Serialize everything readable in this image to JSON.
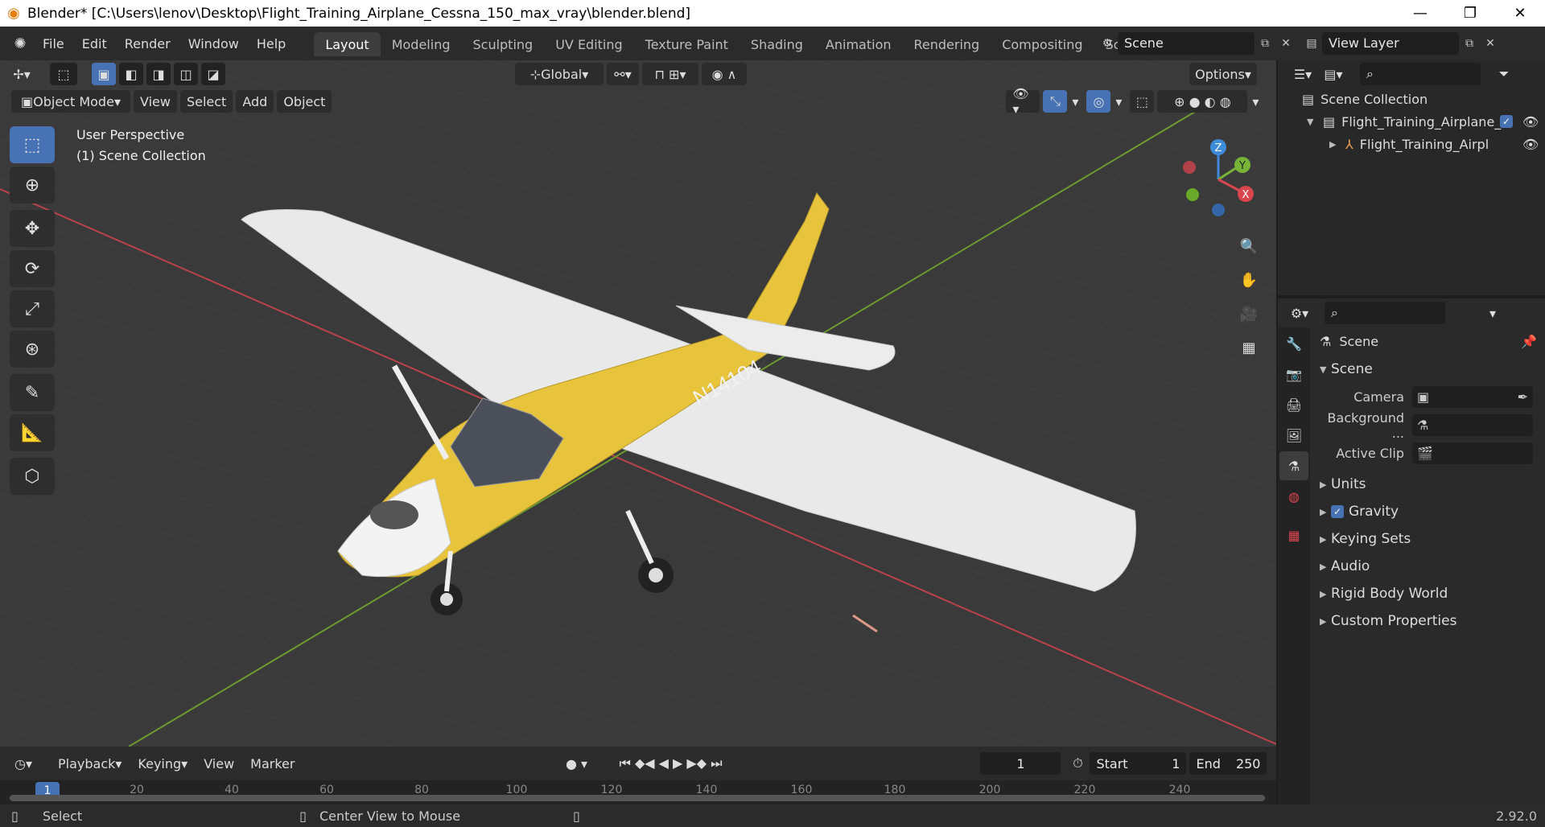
{
  "window": {
    "title": "Blender* [C:\\Users\\lenov\\Desktop\\Flight_Training_Airplane_Cessna_150_max_vray\\blender.blend]",
    "minimize": "—",
    "restore": "❐",
    "close": "✕"
  },
  "menu": [
    "File",
    "Edit",
    "Render",
    "Window",
    "Help"
  ],
  "workspaces": [
    "Layout",
    "Modeling",
    "Sculpting",
    "UV Editing",
    "Texture Paint",
    "Shading",
    "Animation",
    "Rendering",
    "Compositing",
    "Scripting"
  ],
  "active_workspace": "Layout",
  "scene": {
    "name": "Scene",
    "view_layer": "View Layer"
  },
  "viewport": {
    "transform_orientation": "Global",
    "options_label": "Options",
    "mode": "Object Mode",
    "menus": [
      "View",
      "Select",
      "Add",
      "Object"
    ],
    "perspective": "User Perspective",
    "collection": "(1) Scene Collection",
    "axis_x": "X",
    "axis_y": "Y",
    "axis_z": "Z",
    "tail_text": "N14104"
  },
  "outliner": {
    "root": "Scene Collection",
    "collection": "Flight_Training_Airplane_",
    "object": "Flight_Training_Airpl"
  },
  "properties": {
    "context": "Scene",
    "section_title": "Scene",
    "camera_label": "Camera",
    "background_label": "Background ...",
    "active_clip_label": "Active Clip",
    "subpanels": [
      "Units",
      "Gravity",
      "Keying Sets",
      "Audio",
      "Rigid Body World",
      "Custom Properties"
    ]
  },
  "timeline": {
    "menus": [
      "Playback",
      "Keying",
      "View",
      "Marker"
    ],
    "current_frame": "1",
    "start_label": "Start",
    "start": "1",
    "end_label": "End",
    "end": "250",
    "ticks": [
      "1",
      "20",
      "40",
      "60",
      "80",
      "100",
      "120",
      "140",
      "160",
      "180",
      "200",
      "220",
      "240"
    ]
  },
  "status": {
    "select": "Select",
    "center_view": "Center View to Mouse",
    "version": "2.92.0"
  },
  "colors": {
    "accent": "#4772b3",
    "fuselage_yellow": "#e8c43c",
    "x_axis": "#d9464e",
    "y_axis": "#78b438",
    "z_axis": "#3d8bd9"
  }
}
